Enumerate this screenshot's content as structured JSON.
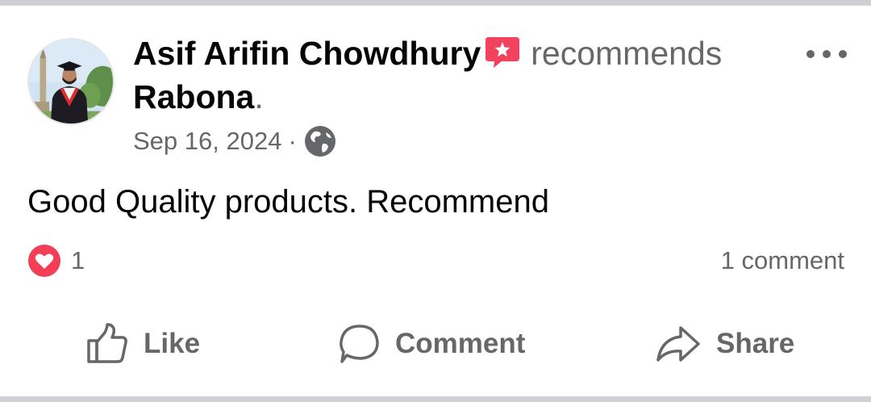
{
  "post": {
    "author": "Asif Arifin Chowdhury",
    "action": "recommends",
    "page": "Rabona",
    "page_suffix": ".",
    "date": "Sep 16, 2024",
    "separator": "·",
    "audience_icon": "globe-icon",
    "text": "Good Quality products. Recommend"
  },
  "reactions": {
    "icon": "love-reaction-icon",
    "count": "1"
  },
  "comments": {
    "label": "1 comment"
  },
  "actions": {
    "like": "Like",
    "comment": "Comment",
    "share": "Share"
  },
  "colors": {
    "text_primary": "#050505",
    "text_secondary": "#65676b",
    "recommend_badge": "#f3425f",
    "love": "#f33e58",
    "divider": "#ced0d4"
  }
}
